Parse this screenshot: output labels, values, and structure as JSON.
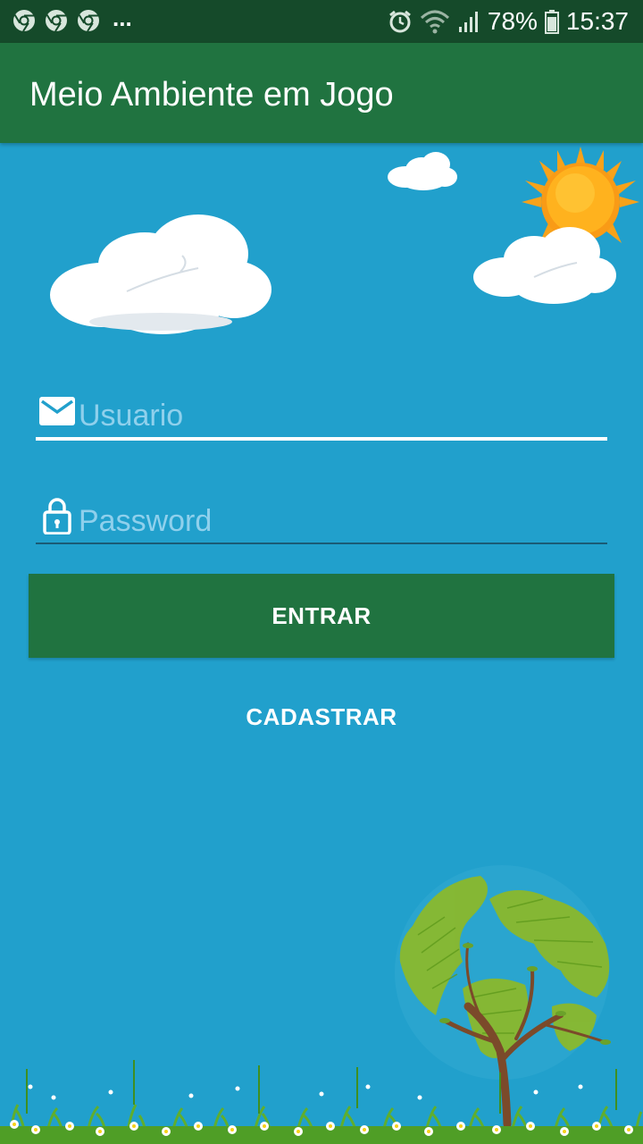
{
  "status_bar": {
    "overflow": "...",
    "battery": "78%",
    "time": "15:37",
    "icons": [
      "chrome-icon",
      "chrome-icon",
      "chrome-icon",
      "alarm-icon",
      "wifi-icon",
      "signal-icon",
      "battery-icon"
    ]
  },
  "app_bar": {
    "title": "Meio Ambiente em Jogo"
  },
  "login": {
    "username_placeholder": "Usuario",
    "password_placeholder": "Password",
    "username_icon": "mail-icon",
    "password_icon": "lock-icon",
    "enter_label": "ENTRAR",
    "register_label": "CADASTRAR"
  },
  "colors": {
    "background": "#21a0cc",
    "app_bar": "#207340",
    "status_bar": "#154a2a",
    "button": "#207340",
    "placeholder": "#8fd0ec"
  }
}
